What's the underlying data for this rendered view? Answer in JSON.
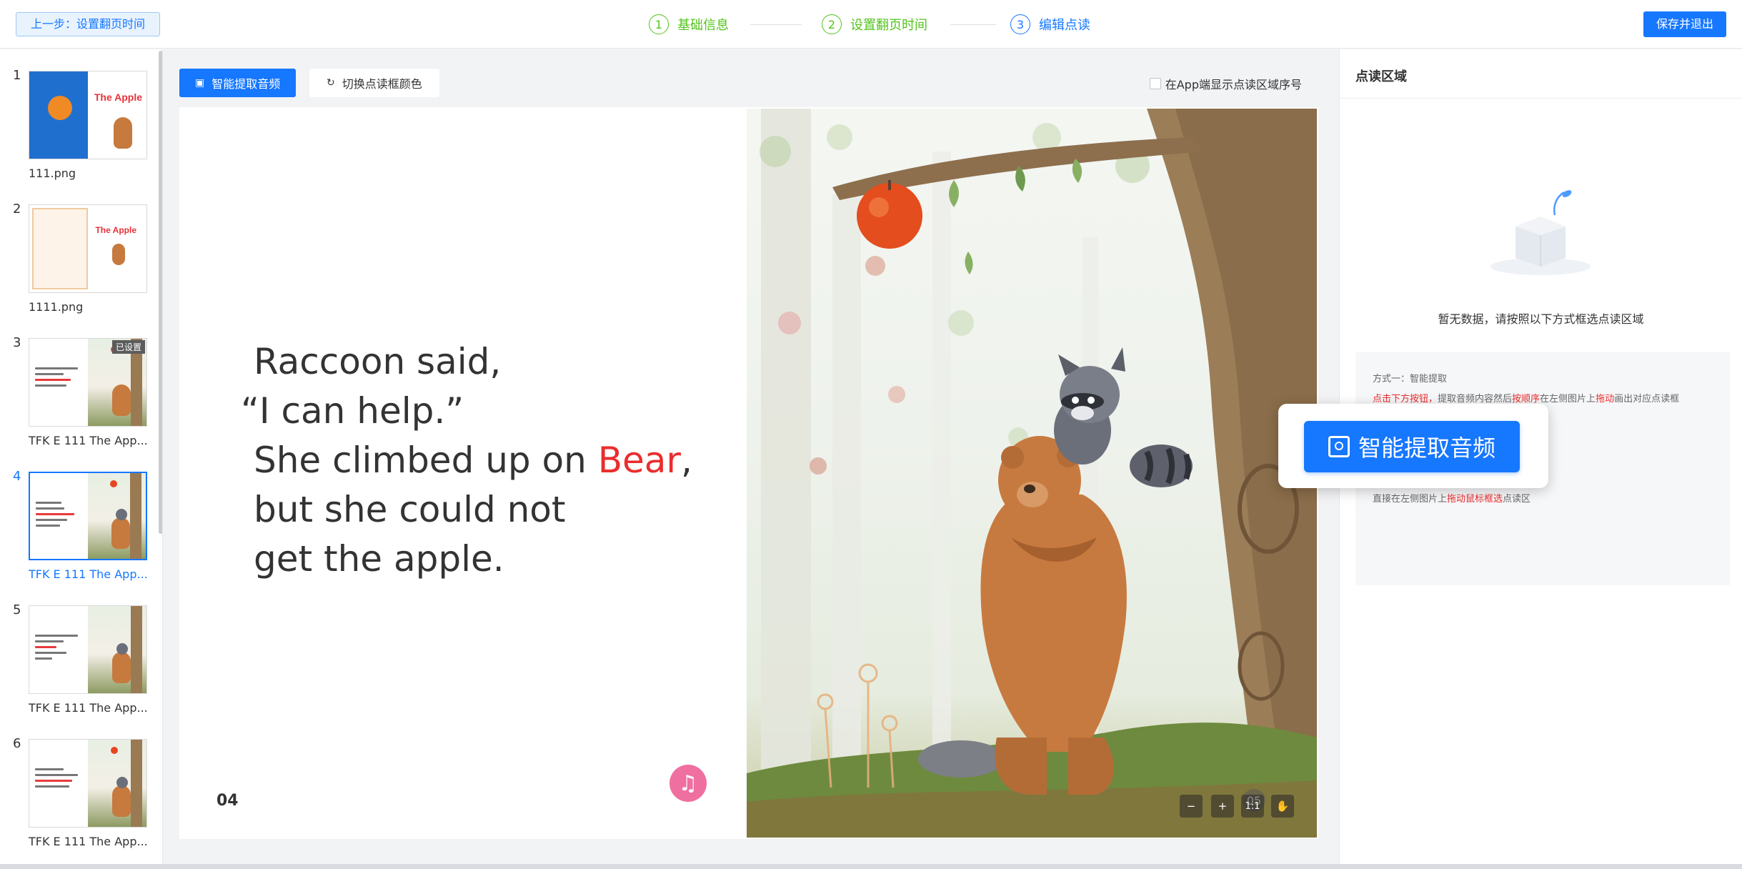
{
  "header": {
    "back_label": "上一步：设置翻页时间",
    "save_label": "保存并退出",
    "steps": [
      {
        "num": "1",
        "label": "基础信息",
        "state": "done"
      },
      {
        "num": "2",
        "label": "设置翻页时间",
        "state": "done"
      },
      {
        "num": "3",
        "label": "编辑点读",
        "state": "active"
      }
    ]
  },
  "sidebar": {
    "pages": [
      {
        "num": "1",
        "name": "111.png",
        "thumb_title": "The Apple"
      },
      {
        "num": "2",
        "name": "1111.png",
        "thumb_title": "The Apple"
      },
      {
        "num": "3",
        "name": "TFK E 111 The App...",
        "badge": "已设置"
      },
      {
        "num": "4",
        "name": "TFK E 111 The App...",
        "selected": true
      },
      {
        "num": "5",
        "name": "TFK E 111 The App..."
      },
      {
        "num": "6",
        "name": "TFK E 111 The App..."
      }
    ]
  },
  "toolbar": {
    "extract_audio_label": "智能提取音频",
    "switch_color_label": "切换点读框颜色",
    "show_index_label": "在App端显示点读区域序号"
  },
  "canvas": {
    "story_lines": [
      "Raccoon said,",
      "“I can help.”",
      "She climbed up on ",
      "but she could not",
      "get the apple."
    ],
    "story_highlight": "Bear",
    "story_suffix": ",",
    "left_page_number": "04",
    "right_page_number": "05",
    "zoom_ratio": "1:1"
  },
  "right_panel": {
    "title": "点读区域",
    "empty_text": "暂无数据，请按照以下方式框选点读区域",
    "method_one": "方式一：智能提取",
    "method_one_red_a": "点击下方按钮，",
    "method_one_mid": "提取音频内容然后",
    "method_one_red_b": "按顺序",
    "method_one_mid2": "在左侧图片上",
    "method_one_red_c": "拖动",
    "method_one_end": "画出对应点读框",
    "method_two_pre": "直接在左侧图片上",
    "method_two_red": "拖动鼠标框选",
    "method_two_end": "点读区"
  },
  "popup": {
    "button_label": "智能提取音频"
  },
  "colors": {
    "primary": "#1677ff",
    "step_done": "#52c41a",
    "highlight_red": "#ea2d2d"
  }
}
